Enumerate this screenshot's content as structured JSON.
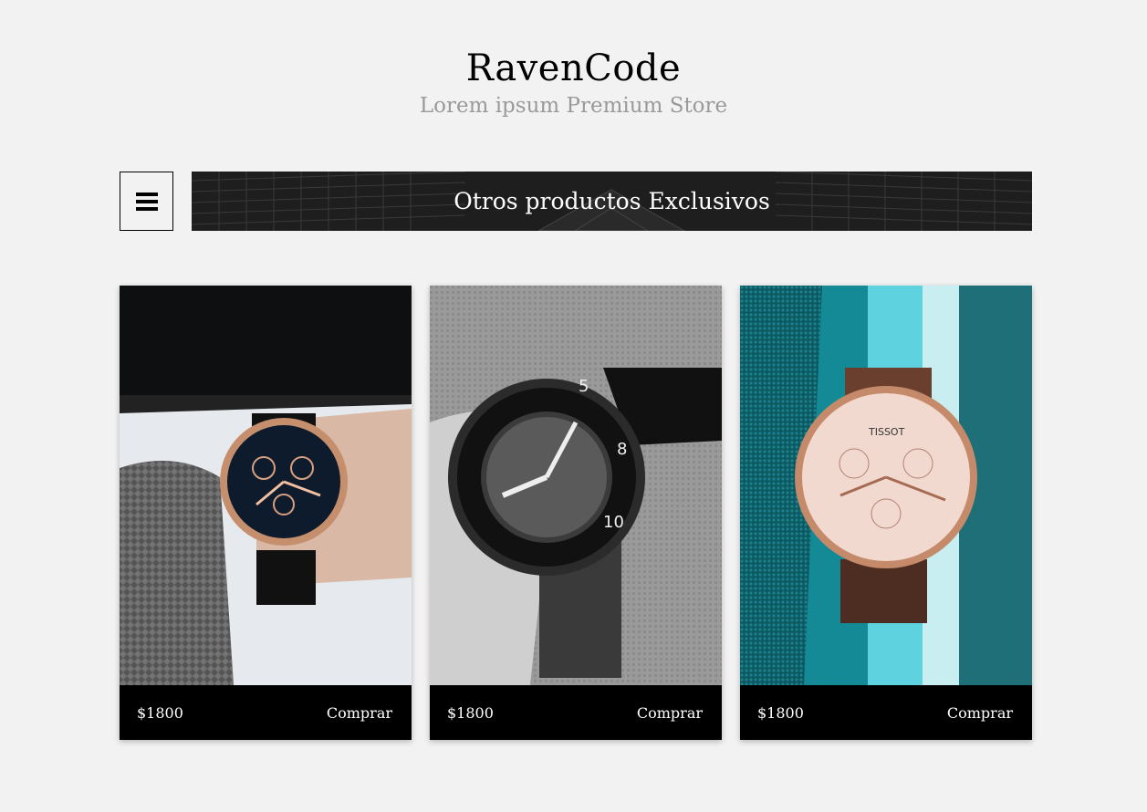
{
  "header": {
    "title": "RavenCode",
    "subtitle": "Lorem ipsum Premium Store"
  },
  "menu": {
    "icon": "hamburger-menu-icon"
  },
  "banner": {
    "title": "Otros productos Exclusivos"
  },
  "products": [
    {
      "image": "watch-on-wrist-photo",
      "price": "$1800",
      "buy_label": "Comprar"
    },
    {
      "image": "diver-watch-bw-photo",
      "price": "$1800",
      "buy_label": "Comprar"
    },
    {
      "image": "tissot-watch-photo",
      "price": "$1800",
      "buy_label": "Comprar"
    }
  ],
  "colors": {
    "background": "#f2f2f2",
    "subtitle": "#9a9a9a",
    "card_footer": "#000000",
    "banner": "#1e1e1e"
  }
}
